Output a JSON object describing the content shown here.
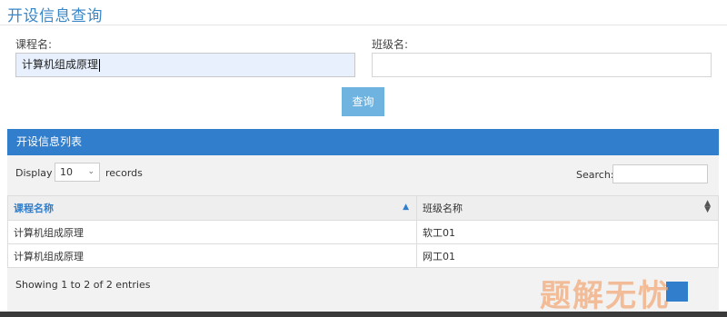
{
  "page": {
    "title": "开设信息查询"
  },
  "form": {
    "course_label": "课程名:",
    "course_value": "计算机组成原理",
    "class_label": "班级名:",
    "class_value": "",
    "query_button": "查询"
  },
  "panel": {
    "header": "开设信息列表",
    "display_label": "Display",
    "length_selected": "10",
    "records_label": "records",
    "search_label": "Search:",
    "search_value": "",
    "columns": [
      "课程名称",
      "班级名称"
    ],
    "rows": [
      [
        "计算机组成原理",
        "软工01"
      ],
      [
        "计算机组成原理",
        "网工01"
      ]
    ],
    "info": "Showing 1 to 2 of 2 entries"
  },
  "watermark": "题解无忧",
  "colors": {
    "accent": "#307ecc",
    "title": "#3a87c8",
    "button": "#6fb3e0",
    "input_autofill": "#e8f0fe"
  },
  "icons": {
    "sort_asc": "triangle-up",
    "sort_both": "up-down-arrows",
    "select_chevron": "chevron-down"
  }
}
